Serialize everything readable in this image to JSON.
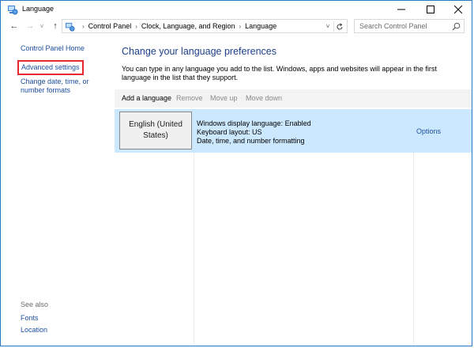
{
  "window": {
    "title": "Language",
    "minimize_glyph": "—",
    "maximize_glyph": "☐",
    "close_glyph": "✕"
  },
  "navigation": {
    "back_glyph": "←",
    "forward_glyph": "→",
    "recent_glyph": "˅",
    "up_glyph": "↑"
  },
  "address_bar": {
    "breadcrumb": [
      "Control Panel",
      "Clock, Language, and Region",
      "Language"
    ],
    "separator": "›",
    "dropdown_glyph": "˅"
  },
  "search": {
    "placeholder": "Search Control Panel"
  },
  "sidebar": {
    "home_link": "Control Panel Home",
    "advanced_settings": "Advanced settings",
    "change_datetime": "Change date, time, or number formats",
    "see_also_label": "See also",
    "see_also_links": [
      "Fonts",
      "Location"
    ]
  },
  "main": {
    "heading": "Change your language preferences",
    "description": "You can type in any language you add to the list. Windows, apps and websites will appear in the first language in the list that they support.",
    "toolbar": {
      "add": "Add a language",
      "remove": "Remove",
      "move_up": "Move up",
      "move_down": "Move down"
    },
    "languages": [
      {
        "name": "English (United States)",
        "details": [
          "Windows display language: Enabled",
          "Keyboard layout: US",
          "Date, time, and number formatting"
        ],
        "options_label": "Options"
      }
    ]
  },
  "colors": {
    "link": "#1e50a0",
    "heading": "#1e3f8c",
    "selected_row": "#cce8ff",
    "highlight_box": "#e5272e",
    "window_border": "#2b78c4"
  }
}
